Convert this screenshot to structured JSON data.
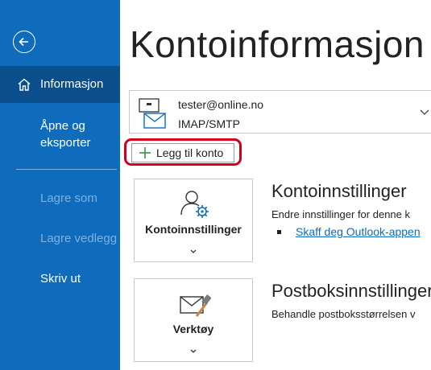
{
  "sidebar": {
    "items": [
      {
        "label": "Informasjon",
        "active": true
      },
      {
        "label_line1": "Åpne og",
        "label_line2": "eksporter"
      },
      {
        "label": "Lagre som",
        "disabled": true
      },
      {
        "label": "Lagre vedlegg",
        "disabled": true
      },
      {
        "label": "Skriv ut"
      }
    ]
  },
  "page": {
    "title": "Kontoinformasjon"
  },
  "account": {
    "email": "tester@online.no",
    "type": "IMAP/SMTP"
  },
  "add_account": {
    "label": "Legg til konto"
  },
  "sections": [
    {
      "card_label": "Kontoinnstillinger",
      "title": "Kontoinnstillinger",
      "description": "Endre innstillinger for denne k",
      "link": "Skaff deg Outlook-appen"
    },
    {
      "card_label": "Verktøy",
      "title": "Postboksinnstillinger",
      "description": "Behandle postboksstørrelsen v"
    }
  ],
  "colors": {
    "sidebar": "#0f6cbd",
    "sidebar_active": "#0b4e8c",
    "highlight": "#d0021b",
    "link": "#0f6cbd"
  }
}
